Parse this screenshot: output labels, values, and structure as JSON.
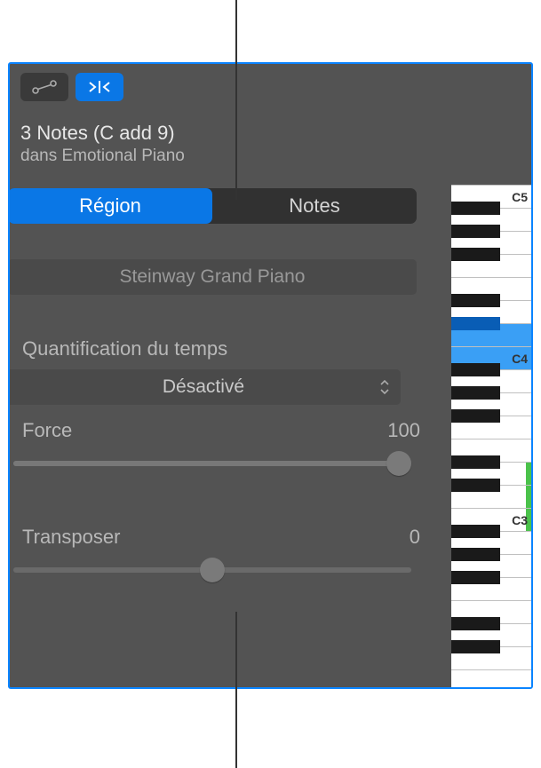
{
  "header": {
    "title": "3 Notes (C add 9)",
    "subtitle": "dans Emotional Piano"
  },
  "tabs": {
    "region": "Région",
    "notes": "Notes"
  },
  "instrument": {
    "name": "Steinway Grand Piano"
  },
  "quantize": {
    "label": "Quantification du temps",
    "value": "Désactivé"
  },
  "force": {
    "label": "Force",
    "value": "100"
  },
  "transpose": {
    "label": "Transposer",
    "value": "0"
  },
  "piano": {
    "labels": {
      "c5": "C5",
      "c4": "C4",
      "c3": "C3"
    }
  },
  "icons": {
    "automation": "automation-icon",
    "catch": "catch-icon"
  }
}
